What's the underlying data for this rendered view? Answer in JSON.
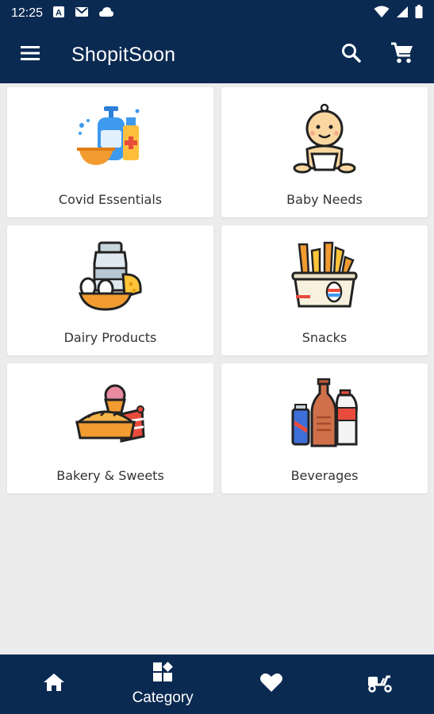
{
  "status_bar": {
    "time": "12:25",
    "icons": [
      "text-a-notification-icon",
      "gmail-icon",
      "cloud-icon",
      "wifi-icon",
      "signal-icon",
      "battery-icon"
    ]
  },
  "app_bar": {
    "title": "ShopitSoon",
    "icons": [
      "menu-icon",
      "search-icon",
      "cart-icon"
    ]
  },
  "categories": [
    {
      "label": "Covid Essentials",
      "icon": "sanitizer-icon"
    },
    {
      "label": "Baby Needs",
      "icon": "baby-icon"
    },
    {
      "label": "Dairy Products",
      "icon": "dairy-icon"
    },
    {
      "label": "Snacks",
      "icon": "snacks-icon"
    },
    {
      "label": "Bakery & Sweets",
      "icon": "bakery-icon"
    },
    {
      "label": "Beverages",
      "icon": "beverages-icon"
    }
  ],
  "bottom_nav": {
    "items": [
      {
        "icon": "home-icon",
        "label": ""
      },
      {
        "icon": "category-icon",
        "label": "Category",
        "selected": true
      },
      {
        "icon": "heart-icon",
        "label": ""
      },
      {
        "icon": "delivery-scooter-icon",
        "label": ""
      }
    ]
  },
  "colors": {
    "primary": "#0b2a52",
    "background": "#ececec",
    "card": "#ffffff"
  }
}
